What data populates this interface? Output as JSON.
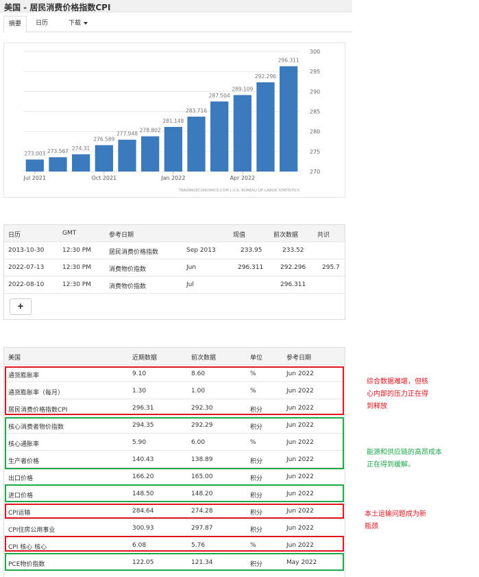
{
  "page_title": "美国 - 居民消费价格指数CPI",
  "tabs": [
    {
      "label": "摘要",
      "active": true
    },
    {
      "label": "日历",
      "active": false
    },
    {
      "label": "下载",
      "active": false
    }
  ],
  "chart_data": {
    "type": "bar",
    "categories": [
      "Jul 2021",
      "Aug 2021",
      "Sep 2021",
      "Oct 2021",
      "Nov 2021",
      "Dec 2021",
      "Jan 2022",
      "Feb 2022",
      "Mar 2022",
      "Apr 2022",
      "May 2022",
      "Jun 2022"
    ],
    "values": [
      273.003,
      273.567,
      274.31,
      276.589,
      277.948,
      278.802,
      281.148,
      283.716,
      287.504,
      289.109,
      292.296,
      296.311
    ],
    "x_tick_labels": [
      "Jul 2021",
      "Oct 2021",
      "Jan 2022",
      "Apr 2022"
    ],
    "ylim": [
      270,
      300
    ],
    "y_ticks": [
      270,
      275,
      280,
      285,
      290,
      295,
      300
    ],
    "y_axis_position": "right",
    "bar_color": "#3b7abd",
    "grid": true,
    "source": "TRADINGECONOMICS.COM | U.S. BUREAU OF LABOR STATISTICS"
  },
  "calendar": {
    "headers": [
      "日历",
      "GMT",
      "参考日期",
      "",
      "现值",
      "前次数据",
      "共识"
    ],
    "rows": [
      [
        "2013-10-30",
        "12:30 PM",
        "居民消费价格指数",
        "Sep 2013",
        "233.95",
        "233.52",
        ""
      ],
      [
        "2022-07-13",
        "12:30 PM",
        "消费物价指数",
        "Jun",
        "296.311",
        "292.296",
        "295.7"
      ],
      [
        "2022-08-10",
        "12:30 PM",
        "消费物价指数",
        "Jul",
        "",
        "296.311",
        ""
      ]
    ],
    "add_label": "+"
  },
  "indicators": {
    "headers": [
      "美国",
      "近期数据",
      "前次数据",
      "单位",
      "参考日期"
    ],
    "rows": [
      [
        "通货膨胀率",
        "9.10",
        "8.60",
        "%",
        "Jun 2022"
      ],
      [
        "通货膨胀率（每月）",
        "1.30",
        "1.00",
        "%",
        "Jun 2022"
      ],
      [
        "居民消费价格指数CPI",
        "296.31",
        "292.30",
        "积分",
        "Jun 2022"
      ],
      [
        "核心消费者物价指数",
        "294.35",
        "292.29",
        "积分",
        "Jun 2022"
      ],
      [
        "核心通胀率",
        "5.90",
        "6.00",
        "%",
        "Jun 2022"
      ],
      [
        "生产者价格",
        "140.43",
        "138.89",
        "积分",
        "Jun 2022"
      ],
      [
        "出口价格",
        "166.20",
        "165.00",
        "积分",
        "Jun 2022"
      ],
      [
        "进口价格",
        "148.50",
        "148.20",
        "积分",
        "Jun 2022"
      ],
      [
        "CPI运输",
        "284.64",
        "274.28",
        "积分",
        "Jun 2022"
      ],
      [
        "CPI住房公用事业",
        "300.93",
        "297.87",
        "积分",
        "Jun 2022"
      ],
      [
        "CPI 核心 核心",
        "6.08",
        "5.76",
        "%",
        "Jun 2022"
      ],
      [
        "PCE物价指数",
        "122.05",
        "121.34",
        "积分",
        "May 2022"
      ]
    ]
  },
  "annotations": {
    "red_note_1": [
      "综合数据难堪，但核",
      "心内部的压力正在得",
      "到释放"
    ],
    "green_note": [
      "能源和供应链的高昂成本",
      "正在得到缓解。"
    ],
    "red_note_2": [
      "本土运输问题成为新",
      "瓶颈"
    ],
    "colors": {
      "red": "#e1131c",
      "green": "#1ea84a"
    }
  }
}
